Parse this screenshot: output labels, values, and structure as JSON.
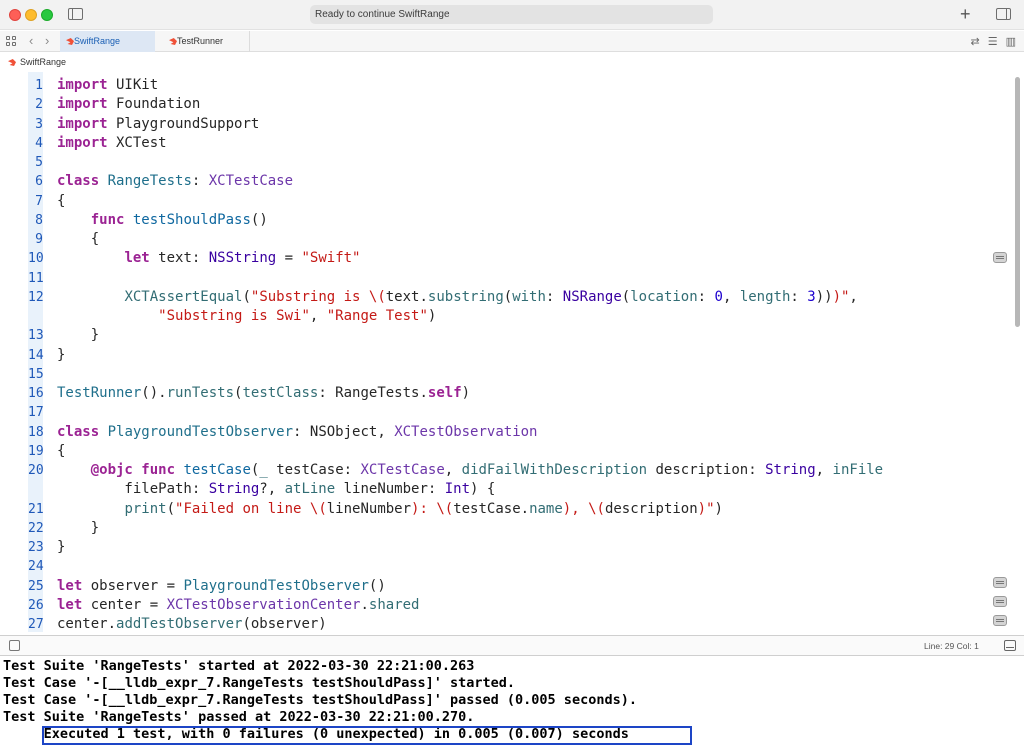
{
  "window": {
    "status_text": "Ready to continue SwiftRange"
  },
  "tabs": [
    {
      "label": "SwiftRange",
      "active": true
    },
    {
      "label": "TestRunner",
      "active": false
    }
  ],
  "breadcrumb": {
    "label": "SwiftRange"
  },
  "editor": {
    "lines": [
      {
        "num": "1",
        "html": "<span class=\"kw\">import</span> UIKit"
      },
      {
        "num": "2",
        "html": "<span class=\"kw\">import</span> Foundation"
      },
      {
        "num": "3",
        "html": "<span class=\"kw\">import</span> PlaygroundSupport"
      },
      {
        "num": "4",
        "html": "<span class=\"kw\">import</span> XCTest"
      },
      {
        "num": "5",
        "html": ""
      },
      {
        "num": "6",
        "html": "<span class=\"kw\">class</span> <span class=\"ty2\">RangeTests</span>: <span class=\"ty3\">XCTestCase</span>"
      },
      {
        "num": "7",
        "html": "{"
      },
      {
        "num": "8",
        "html": "    <span class=\"kw\">func</span> <span class=\"fn2\">testShouldPass</span>()"
      },
      {
        "num": "9",
        "html": "    {"
      },
      {
        "num": "10",
        "html": "        <span class=\"kw\">let</span> text: <span class=\"ty\">NSString</span> = <span class=\"str\">\"Swift\"</span>"
      },
      {
        "num": "11",
        "html": ""
      },
      {
        "num": "12",
        "html": "        <span class=\"fn\">XCTAssertEqual</span>(<span class=\"str\">\"Substring is \\(</span>text.<span class=\"fn\">substring</span>(<span class=\"fn\">with</span>: <span class=\"ty\">NSRange</span>(<span class=\"fn\">location</span>: <span class=\"num\">0</span>, <span class=\"fn\">length</span>: <span class=\"num\">3</span>))<span class=\"str\">)\"</span>,"
      },
      {
        "num": "",
        "html": "            <span class=\"str\">\"Substring is Swi\"</span>, <span class=\"str\">\"Range Test\"</span>)"
      },
      {
        "num": "13",
        "html": "    }"
      },
      {
        "num": "14",
        "html": "}"
      },
      {
        "num": "15",
        "html": ""
      },
      {
        "num": "16",
        "html": "<span class=\"ty2\">TestRunner</span>().<span class=\"fn\">runTests</span>(<span class=\"fn\">testClass</span>: RangeTests.<span class=\"kw\">self</span>)"
      },
      {
        "num": "17",
        "html": ""
      },
      {
        "num": "18",
        "html": "<span class=\"kw\">class</span> <span class=\"ty2\">PlaygroundTestObserver</span>: NSObject, <span class=\"ty3\">XCTestObservation</span>"
      },
      {
        "num": "19",
        "html": "{"
      },
      {
        "num": "20",
        "html": "    <span class=\"kw\">@objc func</span> <span class=\"fn2\">testCase</span>(<span class=\"fn\">_</span> testCase: <span class=\"ty3\">XCTestCase</span>, <span class=\"fn\">didFailWithDescription</span> description: <span class=\"ty\">String</span>, <span class=\"fn\">inFile</span>"
      },
      {
        "num": "",
        "html": "        filePath: <span class=\"ty\">String</span>?, <span class=\"fn\">atLine</span> lineNumber: <span class=\"ty\">Int</span>) {"
      },
      {
        "num": "21",
        "html": "        <span class=\"fn\">print</span>(<span class=\"str\">\"Failed on line \\(</span>lineNumber<span class=\"str\">): \\(</span>testCase.<span class=\"fn\">name</span><span class=\"str\">), \\(</span>description<span class=\"str\">)\"</span>)"
      },
      {
        "num": "22",
        "html": "    }"
      },
      {
        "num": "23",
        "html": "}"
      },
      {
        "num": "24",
        "html": ""
      },
      {
        "num": "25",
        "html": "<span class=\"kw\">let</span> observer = <span class=\"ty2\">PlaygroundTestObserver</span>()"
      },
      {
        "num": "26",
        "html": "<span class=\"kw\">let</span> center = <span class=\"ty3\">XCTestObservationCenter</span>.<span class=\"fn\">shared</span>"
      },
      {
        "num": "27",
        "html": "center.<span class=\"fn\">addTestObserver</span>(observer)"
      }
    ]
  },
  "debugbar": {
    "line_col": "Line: 29  Col: 1"
  },
  "console": {
    "lines": [
      "Test Suite 'RangeTests' started at 2022-03-30 22:21:00.263",
      "Test Case '-[__lldb_expr_7.RangeTests testShouldPass]' started.",
      "Test Case '-[__lldb_expr_7.RangeTests testShouldPass]' passed (0.005 seconds).",
      "Test Suite 'RangeTests' passed at 2022-03-30 22:21:00.270.",
      "     Executed 1 test, with 0 failures (0 unexpected) in 0.005 (0.007) seconds"
    ]
  }
}
